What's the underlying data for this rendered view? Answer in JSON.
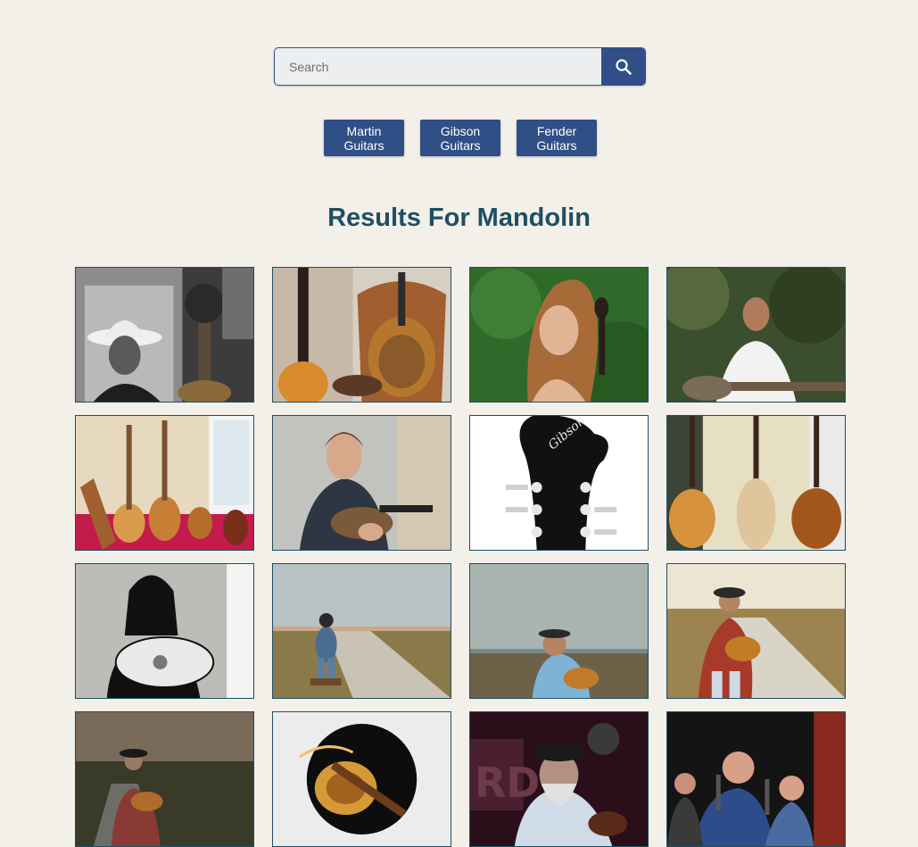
{
  "search": {
    "placeholder": "Search"
  },
  "filters": [
    {
      "label": "Martin\nGuitars"
    },
    {
      "label": "Gibson\nGuitars"
    },
    {
      "label": "Fender\nGuitars"
    }
  ],
  "results": {
    "title": "Results For Mandolin"
  },
  "colors": {
    "accent": "#2f4f86",
    "title": "#1f4f63",
    "background": "#f3efe9"
  },
  "icons": {
    "search_button": "search-icon"
  }
}
